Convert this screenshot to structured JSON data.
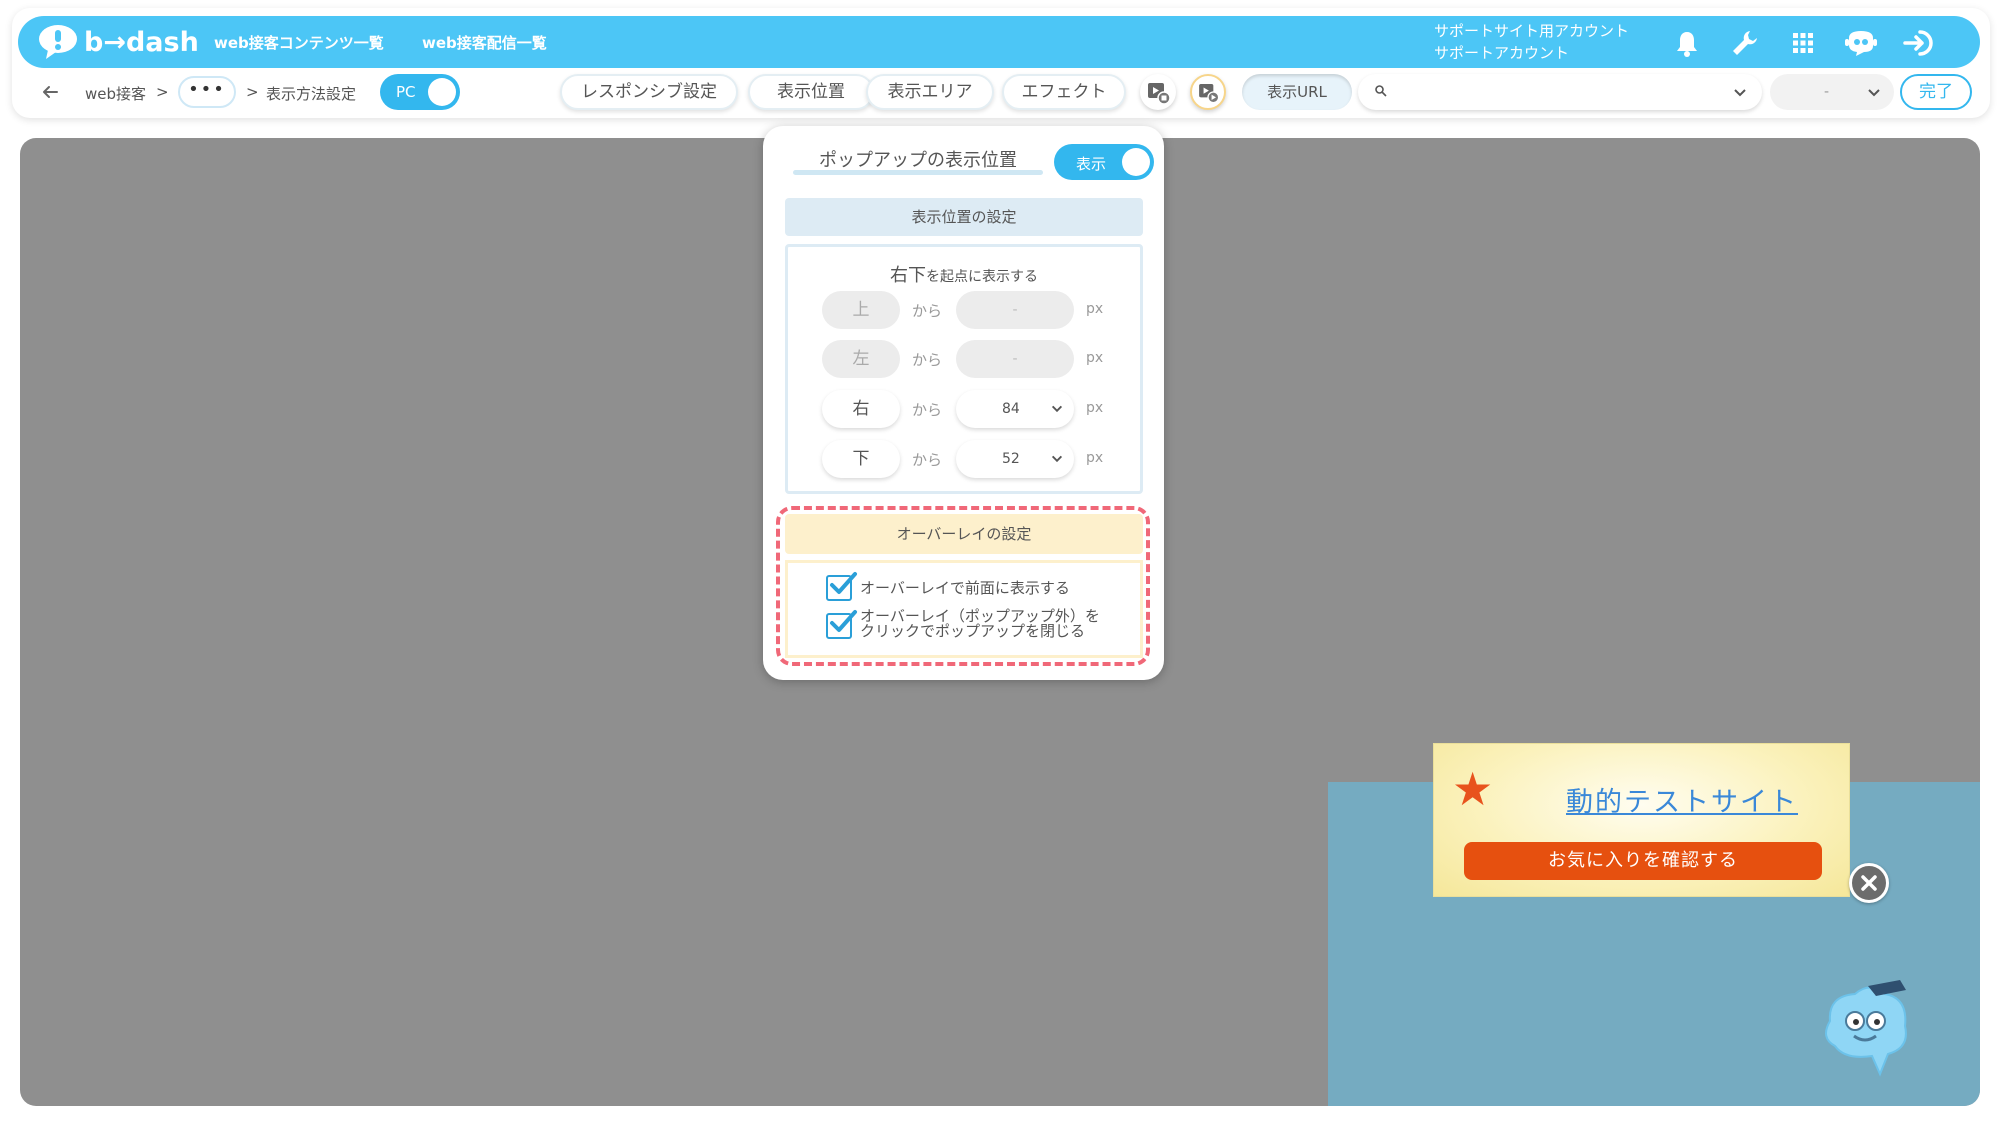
{
  "header": {
    "logo_text": "b→dash",
    "nav": [
      "web接客コンテンツ一覧",
      "web接客配信一覧"
    ],
    "account_line1": "サポートサイト用アカウント",
    "account_line2": "サポートアカウント",
    "icons": [
      "bell-icon",
      "wrench-icon",
      "grid-icon",
      "chat-bot-icon",
      "logout-icon"
    ]
  },
  "toolbar": {
    "breadcrumb": [
      "web接客",
      ">",
      "•••",
      ">",
      "表示方法設定"
    ],
    "device_toggle": "PC",
    "tabs": [
      "レスポンシブ設定",
      "表示位置",
      "表示エリア",
      "エフェクト"
    ],
    "url_label": "表示URL",
    "url_value": "",
    "secondary_select": "-",
    "done_label": "完了"
  },
  "panel": {
    "title": "ポップアップの表示位置",
    "show_toggle": "表示",
    "position_section": "表示位置の設定",
    "origin_big": "右下",
    "origin_small": "を起点に表示する",
    "rows": [
      {
        "dir": "上",
        "from": "から",
        "value": "-",
        "unit": "px",
        "active": false
      },
      {
        "dir": "左",
        "from": "から",
        "value": "-",
        "unit": "px",
        "active": false
      },
      {
        "dir": "右",
        "from": "から",
        "value": "84",
        "unit": "px",
        "active": true
      },
      {
        "dir": "下",
        "from": "から",
        "value": "52",
        "unit": "px",
        "active": true
      }
    ],
    "overlay_section": "オーバーレイの設定",
    "overlay_opt1": "オーバーレイで前面に表示する",
    "overlay_opt2_line1": "オーバーレイ（ポップアップ外）を",
    "overlay_opt2_line2": "クリックでポップアップを閉じる"
  },
  "preview": {
    "popup_title": "動的テストサイト",
    "popup_cta": "お気に入りを確認する"
  },
  "colors": {
    "brand": "#4cc6f6",
    "toggle": "#33b7ee",
    "cta": "#e6500f",
    "dash_border": "#f06878"
  }
}
